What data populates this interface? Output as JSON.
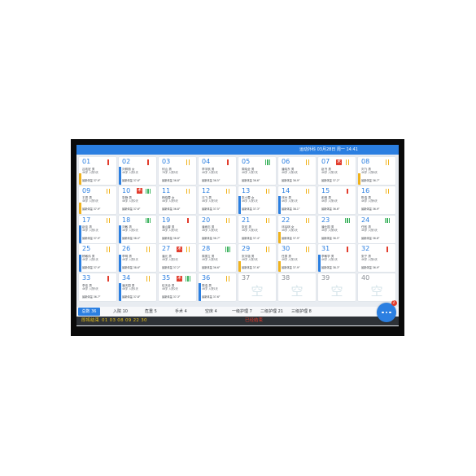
{
  "header": {
    "title": "运动外科 03月28日 周一 14:41"
  },
  "labels": {
    "surgery": "术",
    "empty": "空"
  },
  "colors": {
    "accent": "#2b7fe1",
    "level_1": "#e23c2c",
    "level_2": "#f0b21b",
    "level_3": "#3cb35e",
    "strip_blue": "#2b7fe1",
    "strip_yellow": "#f0b21b",
    "ending_text": "#e8c21a",
    "ended_text": "#e0392b"
  },
  "beds": [
    {
      "no": "01",
      "name": "吕佑宏 男",
      "info": "46岁 入院3天",
      "temp": "最新体温 37.9°",
      "level": 1,
      "surgery": false,
      "strip": "yellow"
    },
    {
      "no": "02",
      "name": "刘佩丽 女",
      "info": "46岁 入院1天",
      "temp": "最新体温 37.6°",
      "level": 1,
      "surgery": false,
      "strip": "blue"
    },
    {
      "no": "03",
      "name": "何山 男",
      "info": "76岁 入院5天",
      "temp": "最新体温 36.8°",
      "level": 2,
      "surgery": false,
      "strip": null
    },
    {
      "no": "04",
      "name": "李宇航 男",
      "info": "46岁 入院2天",
      "temp": "最新体温 36.5°",
      "level": 1,
      "surgery": false,
      "strip": null
    },
    {
      "no": "05",
      "name": "周晓全 男",
      "info": "46岁 入院7天",
      "temp": "最新体温 36.6°",
      "level": 3,
      "surgery": false,
      "strip": null
    },
    {
      "no": "06",
      "name": "潘晓东 男",
      "info": "46岁 入院4天",
      "temp": "最新体温 36.9°",
      "level": 2,
      "surgery": false,
      "strip": null
    },
    {
      "no": "07",
      "name": "赵书 男",
      "info": "46岁 入院2天",
      "temp": "最新体温 37.2°",
      "level": 2,
      "surgery": true,
      "strip": null
    },
    {
      "no": "08",
      "name": "刘飞 男",
      "info": "46岁 入院6天",
      "temp": "最新体温 36.7°",
      "level": 2,
      "surgery": false,
      "strip": "yellow"
    },
    {
      "no": "09",
      "name": "王秀 男",
      "info": "46岁 入院3天",
      "temp": "最新体温 37.9°",
      "level": 2,
      "surgery": false,
      "strip": "yellow"
    },
    {
      "no": "10",
      "name": "张静 男",
      "info": "46岁 入院2天",
      "temp": "最新体温 37.6°",
      "level": 3,
      "surgery": true,
      "strip": null
    },
    {
      "no": "11",
      "name": "杨晓蓉 女",
      "info": "46岁 入院5天",
      "temp": "最新体温 36.8°",
      "level": 2,
      "surgery": false,
      "strip": null
    },
    {
      "no": "12",
      "name": "汪飞 男",
      "info": "46岁 入院3天",
      "temp": "最新体温 37.5°",
      "level": 2,
      "surgery": false,
      "strip": null
    },
    {
      "no": "13",
      "name": "张小蓉 女",
      "info": "46岁 入院1天",
      "temp": "最新体温 37.3°",
      "level": 2,
      "surgery": false,
      "strip": "blue"
    },
    {
      "no": "14",
      "name": "邓州 男",
      "info": "46岁 入院1天",
      "temp": "最新体温 38.1°",
      "level": 2,
      "surgery": false,
      "strip": "blue"
    },
    {
      "no": "15",
      "name": "彭程 男",
      "info": "46岁 入院4天",
      "temp": "最新体温 36.6°",
      "level": 1,
      "surgery": false,
      "strip": null
    },
    {
      "no": "16",
      "name": "陈浩 男",
      "info": "46岁 入院6天",
      "temp": "最新体温 36.9°",
      "level": 2,
      "surgery": false,
      "strip": null
    },
    {
      "no": "17",
      "name": "赵佳 男",
      "info": "46岁 入院1天",
      "temp": "最新体温 37.9°",
      "level": 2,
      "surgery": false,
      "strip": "blue"
    },
    {
      "no": "18",
      "name": "刘敏 男",
      "info": "46岁 入院2天",
      "temp": "最新体温 38.0°",
      "level": 3,
      "surgery": false,
      "strip": "blue"
    },
    {
      "no": "19",
      "name": "潘山雷 男",
      "info": "46岁 入院3天",
      "temp": "最新体温 36.8°",
      "level": 1,
      "surgery": false,
      "strip": null
    },
    {
      "no": "20",
      "name": "潘雨志 男",
      "info": "46岁 入院5天",
      "temp": "最新体温 36.7°",
      "level": 2,
      "surgery": false,
      "strip": null
    },
    {
      "no": "21",
      "name": "张宏 男",
      "info": "46岁 入院4天",
      "temp": "最新体温 37.4°",
      "level": 2,
      "surgery": false,
      "strip": null
    },
    {
      "no": "22",
      "name": "邓泓琪 女",
      "info": "46岁 入院2天",
      "temp": "最新体温 37.9°",
      "level": 2,
      "surgery": false,
      "strip": "yellow"
    },
    {
      "no": "23",
      "name": "潘仕国 男",
      "info": "46岁 入院6天",
      "temp": "最新体温 36.5°",
      "level": 3,
      "surgery": false,
      "strip": null
    },
    {
      "no": "24",
      "name": "任松 男",
      "info": "46岁 入院3天",
      "temp": "最新体温 36.8°",
      "level": 3,
      "surgery": false,
      "strip": null
    },
    {
      "no": "25",
      "name": "杨敏伟 男",
      "info": "46岁 入院1天",
      "temp": "最新体温 37.9°",
      "level": 2,
      "surgery": false,
      "strip": "blue"
    },
    {
      "no": "26",
      "name": "李明 男",
      "info": "46岁 入院1天",
      "temp": "最新体温 38.6°",
      "level": 2,
      "surgery": false,
      "strip": "blue"
    },
    {
      "no": "27",
      "name": "潘元 男",
      "info": "46岁 入院2天",
      "temp": "最新体温 37.2°",
      "level": 2,
      "surgery": true,
      "strip": null
    },
    {
      "no": "28",
      "name": "周振立 男",
      "info": "46岁 入院5天",
      "temp": "最新体温 36.6°",
      "level": 3,
      "surgery": false,
      "strip": null
    },
    {
      "no": "29",
      "name": "张宇强 男",
      "info": "46岁 入院3天",
      "temp": "最新体温 37.6°",
      "level": 2,
      "surgery": false,
      "strip": "yellow"
    },
    {
      "no": "30",
      "name": "任振 男",
      "info": "46岁 入院2天",
      "temp": "最新体温 37.9°",
      "level": 2,
      "surgery": false,
      "strip": "yellow"
    },
    {
      "no": "31",
      "name": "李敏学 男",
      "info": "46岁 入院1天",
      "temp": "最新体温 38.3°",
      "level": 1,
      "surgery": false,
      "strip": "blue"
    },
    {
      "no": "32",
      "name": "张宁 男",
      "info": "46岁 入院4天",
      "temp": "最新体温 36.9°",
      "level": 1,
      "surgery": false,
      "strip": null
    },
    {
      "no": "33",
      "name": "李佳 男",
      "info": "46岁 入院5天",
      "temp": "最新体温 36.7°",
      "level": 1,
      "surgery": false,
      "strip": null
    },
    {
      "no": "34",
      "name": "潘天国 男",
      "info": "46岁 入院1天",
      "temp": "最新体温 37.8°",
      "level": 2,
      "surgery": false,
      "strip": "blue"
    },
    {
      "no": "35",
      "name": "伍天全 男",
      "info": "46岁 入院2天",
      "temp": "最新体温 37.3°",
      "level": 3,
      "surgery": true,
      "strip": null
    },
    {
      "no": "36",
      "name": "周浩 男",
      "info": "46岁 入院1天",
      "temp": "最新体温 37.6°",
      "level": 2,
      "surgery": false,
      "strip": "blue"
    },
    {
      "no": "37",
      "empty": true
    },
    {
      "no": "38",
      "empty": true
    },
    {
      "no": "39",
      "empty": true
    },
    {
      "no": "40",
      "empty": true
    }
  ],
  "tabs": [
    {
      "label": "总数 36",
      "active": true
    },
    {
      "label": "入院 10",
      "active": false
    },
    {
      "label": "危重 5",
      "active": false
    },
    {
      "label": "手术 4",
      "active": false
    },
    {
      "label": "空床 4",
      "active": false
    },
    {
      "label": "一级护理 7",
      "active": false
    },
    {
      "label": "二级护理 21",
      "active": false
    },
    {
      "label": "三级护理 8",
      "active": false
    }
  ],
  "footer": {
    "ending_label": "即将结束",
    "ending_beds": "01 03 08 09 22 30",
    "ended_label": "已经结束"
  },
  "chat": {
    "icon": "chat-bubble-icon",
    "badge": "2"
  }
}
